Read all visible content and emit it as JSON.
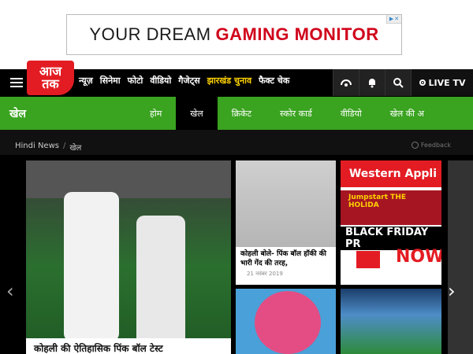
{
  "ad": {
    "text_main": "YOUR DREAM",
    "text_highlight": "GAMING MONITOR",
    "choices_icon": "ad-choices-icon",
    "close_icon": "close-icon"
  },
  "header": {
    "logo_text_top": "आज",
    "logo_text_bottom": "तक",
    "nav": [
      {
        "label": "न्यूज़"
      },
      {
        "label": "सिनेमा"
      },
      {
        "label": "फोटो"
      },
      {
        "label": "वीडियो"
      },
      {
        "label": "गैजेट्स"
      },
      {
        "label": "झारखंड चुनाव",
        "highlight": true
      },
      {
        "label": "फैक्ट चेक"
      }
    ],
    "icons": [
      "podcast-icon",
      "bell-icon",
      "search-icon"
    ],
    "live_tv_label": "LIVE TV"
  },
  "section": {
    "title": "खेल",
    "tabs": [
      {
        "label": "होम"
      },
      {
        "label": "खेल",
        "active": true
      },
      {
        "label": "क्रिकेट"
      },
      {
        "label": "स्कोर कार्ड"
      },
      {
        "label": "वीडियो"
      },
      {
        "label": "खेल की अ"
      }
    ]
  },
  "breadcrumb": {
    "home": "Hindi News",
    "sep": "/",
    "current": "खेल",
    "feedback": "Feedback"
  },
  "hero": {
    "caption": "कोहली की ऐतिहासिक पिंक बॉल टेस्ट"
  },
  "cards": [
    {
      "text": "कोहली बोले- पिंक बॉल हॉकी की भारी गेंद की तरह,",
      "date": "21 नवंबर 2019"
    }
  ],
  "ad2": {
    "brand": "Western Appli",
    "promo": "Jumpstart THE HOLIDA",
    "headline": "BLACK FRIDAY PR",
    "cta": "NOW"
  },
  "colors": {
    "brand_red": "#e31c23",
    "section_green": "#3aa320",
    "highlight_yellow": "#ffd200"
  }
}
